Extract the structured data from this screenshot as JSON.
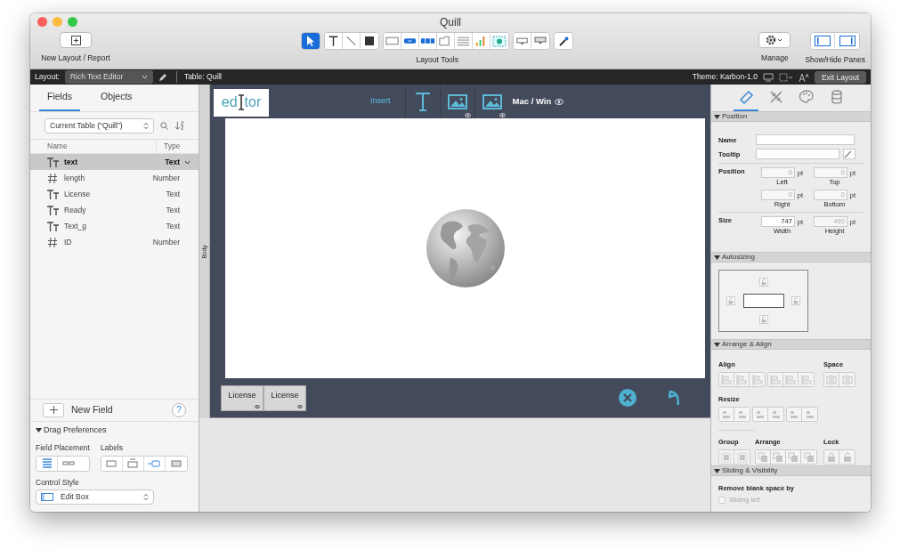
{
  "window": {
    "title": "Quill"
  },
  "toolbar": {
    "new_layout_label": "New Layout / Report",
    "tools_label": "Layout Tools",
    "manage_label": "Manage",
    "panes_label": "Show/Hide Panes",
    "tool_groups": [
      [
        {
          "kind": "pointer",
          "selected": true
        }
      ],
      [
        {
          "kind": "text",
          "selected": false
        },
        {
          "kind": "line",
          "selected": false
        },
        {
          "kind": "rectangle",
          "selected": false
        }
      ],
      [
        {
          "kind": "field",
          "selected": false
        },
        {
          "kind": "button",
          "selected": false
        },
        {
          "kind": "button-bar",
          "selected": false
        },
        {
          "kind": "tab",
          "selected": false
        },
        {
          "kind": "portal",
          "selected": false
        },
        {
          "kind": "chart",
          "selected": false
        },
        {
          "kind": "web-viewer",
          "selected": false
        }
      ],
      [
        {
          "kind": "popover",
          "selected": false
        },
        {
          "kind": "popover-button",
          "selected": false
        }
      ],
      [
        {
          "kind": "eyedropper",
          "selected": false
        }
      ]
    ],
    "panes": [
      {
        "kind": "left",
        "on": true
      },
      {
        "kind": "right",
        "on": true
      }
    ]
  },
  "layout_bar": {
    "layout_label": "Layout:",
    "layout_name": "Rich Text Editor",
    "table": "Table: Quill",
    "theme": "Theme: Karbon-1.0",
    "exit_button": "Exit Layout"
  },
  "left_pane": {
    "tabs": [
      {
        "label": "Fields",
        "selected": true
      },
      {
        "label": "Objects",
        "selected": false
      }
    ],
    "table_select": "Current Table (“Quill”)",
    "columns": [
      "Name",
      "Type"
    ],
    "fields": [
      {
        "kind": "text",
        "name": "text",
        "type": "Text",
        "selected": true
      },
      {
        "kind": "number",
        "name": "length",
        "type": "Number",
        "selected": false
      },
      {
        "kind": "text",
        "name": "License",
        "type": "Text",
        "selected": false
      },
      {
        "kind": "text",
        "name": "Ready",
        "type": "Text",
        "selected": false
      },
      {
        "kind": "text",
        "name": "Text_g",
        "type": "Text",
        "selected": false
      },
      {
        "kind": "number",
        "name": "ID",
        "type": "Number",
        "selected": false
      }
    ],
    "new_field": "New Field",
    "help": "?",
    "drag_preferences": {
      "title": "Drag Preferences",
      "expanded": true,
      "placement_label": "Field Placement",
      "labels_label": "Labels",
      "placement": [
        {
          "kind": "vertical",
          "selected": true
        },
        {
          "kind": "horizontal",
          "selected": false
        }
      ],
      "labels": [
        {
          "kind": "none",
          "selected": false
        },
        {
          "kind": "top",
          "selected": false
        },
        {
          "kind": "left",
          "selected": true
        },
        {
          "kind": "inside",
          "selected": false
        }
      ],
      "control_style_label": "Control Style",
      "control_style": "Edit Box"
    }
  },
  "canvas": {
    "part_label": "Body",
    "logo": [
      "ed",
      "tor"
    ],
    "insert": "Insert",
    "platform": "Mac / Win",
    "footer_buttons": [
      "License",
      "License"
    ]
  },
  "inspector": {
    "tabs": [
      {
        "kind": "position",
        "selected": true
      },
      {
        "kind": "styles",
        "selected": false
      },
      {
        "kind": "appearance",
        "selected": false
      },
      {
        "kind": "data",
        "selected": false
      }
    ],
    "position": {
      "title": "Position",
      "expanded": true,
      "name_label": "Name",
      "tooltip_label": "Tooltip",
      "position_label": "Position",
      "size_label": "Size",
      "coords": [
        {
          "label": "Left",
          "value": "0",
          "unit": "pt",
          "disabled": true
        },
        {
          "label": "Top",
          "value": "0",
          "unit": "pt",
          "disabled": true
        },
        {
          "label": "Right",
          "value": "0",
          "unit": "pt",
          "disabled": true
        },
        {
          "label": "Bottom",
          "value": "0",
          "unit": "pt",
          "disabled": true
        }
      ],
      "size": [
        {
          "label": "Width",
          "value": "747",
          "unit": "pt",
          "disabled": false
        },
        {
          "label": "Height",
          "value": "490",
          "unit": "pt",
          "disabled": true
        }
      ]
    },
    "autosizing": {
      "title": "Autosizing",
      "expanded": true,
      "anchors": [
        {
          "kind": "top",
          "locked": false
        },
        {
          "kind": "left",
          "locked": false
        },
        {
          "kind": "right",
          "locked": false
        },
        {
          "kind": "bottom",
          "locked": false
        }
      ]
    },
    "arrange": {
      "title": "Arrange & Align",
      "expanded": true,
      "groups": [
        {
          "kind": "align",
          "label": "Align",
          "disabled": true,
          "clusters": [
            {
              "buttons": [
                {
                  "kind": "align-left"
                },
                {
                  "kind": "align-center"
                },
                {
                  "kind": "align-right"
                }
              ]
            },
            {
              "buttons": [
                {
                  "kind": "align-top"
                },
                {
                  "kind": "align-middle"
                },
                {
                  "kind": "align-bottom"
                }
              ]
            }
          ]
        },
        {
          "kind": "space",
          "label": "Space",
          "disabled": true,
          "clusters": [
            {
              "buttons": [
                {
                  "kind": "space-horizontal"
                },
                {
                  "kind": "space-vertical"
                }
              ]
            }
          ]
        },
        {
          "kind": "resize",
          "label": "Resize",
          "disabled": true,
          "clusters": [
            {
              "buttons": [
                {
                  "kind": "resize-narrowest"
                },
                {
                  "kind": "resize-widest"
                }
              ]
            },
            {
              "buttons": [
                {
                  "kind": "resize-shortest"
                },
                {
                  "kind": "resize-tallest"
                }
              ]
            },
            {
              "buttons": [
                {
                  "kind": "resize-smallest"
                },
                {
                  "kind": "resize-largest"
                }
              ]
            }
          ]
        },
        {
          "kind": "group",
          "label": "Group",
          "disabled": true,
          "clusters": [
            {
              "buttons": [
                {
                  "kind": "group"
                },
                {
                  "kind": "ungroup"
                }
              ]
            }
          ]
        },
        {
          "kind": "arrange",
          "label": "Arrange",
          "disabled": true,
          "clusters": [
            {
              "buttons": [
                {
                  "kind": "bring-front"
                },
                {
                  "kind": "bring-forward"
                },
                {
                  "kind": "send-backward"
                },
                {
                  "kind": "send-back"
                }
              ]
            }
          ]
        },
        {
          "kind": "lock",
          "label": "Lock",
          "disabled": true,
          "clusters": [
            {
              "buttons": [
                {
                  "kind": "lock"
                },
                {
                  "kind": "unlock"
                }
              ]
            }
          ]
        }
      ]
    },
    "sliding": {
      "title": "Sliding & Visibility",
      "expanded": true,
      "remove_label": "Remove blank space by",
      "option": {
        "label": "Sliding left",
        "checked": false,
        "disabled": true
      }
    }
  }
}
